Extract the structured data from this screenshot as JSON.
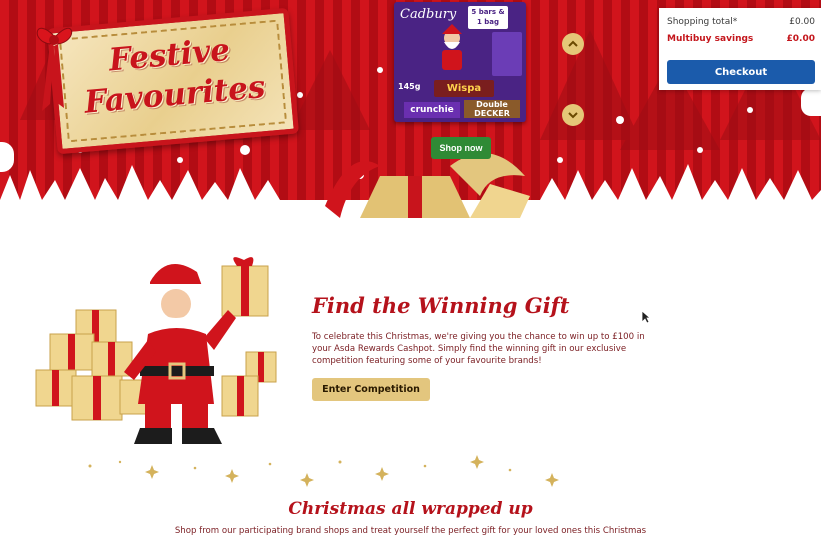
{
  "banner": {
    "title_line1": "Festive",
    "title_line2": "Favourites",
    "shop_now_label": "Shop now",
    "product": {
      "brand": "Cadbury",
      "badge": "5 bars & 1 bag",
      "weight": "145g",
      "bar_wispa": "Wispa",
      "bar_crunchie": "crunchie",
      "bar_double_decker": "Double DECKER"
    }
  },
  "basket": {
    "shopping_total_label": "Shopping total*",
    "shopping_total_value": "£0.00",
    "multibuy_label": "Multibuy savings",
    "multibuy_value": "£0.00",
    "checkout_label": "Checkout"
  },
  "competition": {
    "title": "Find the Winning Gift",
    "body": "To celebrate this Christmas, we're giving you the chance to win up to £100 in your Asda Rewards Cashpot. Simply find the winning gift in our exclusive competition featuring some of your favourite brands!",
    "cta_label": "Enter Competition"
  },
  "wrapped": {
    "title": "Christmas all wrapped up",
    "body": "Shop from our participating brand shops and treat yourself the perfect gift for your loved ones this Christmas"
  },
  "colors": {
    "brand_red": "#c4161c",
    "checkout_blue": "#1b5bab",
    "shop_green": "#2f8a35",
    "gold": "#e3c67e"
  },
  "icons": {
    "up": "chevron-up-icon",
    "down": "chevron-down-icon"
  }
}
